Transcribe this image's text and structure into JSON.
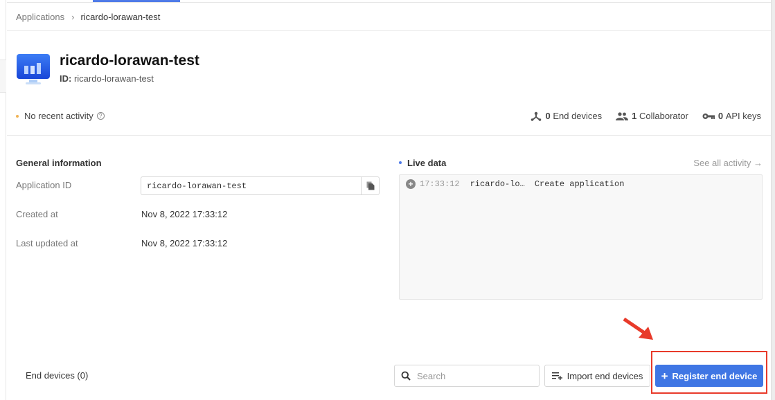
{
  "breadcrumb": {
    "parent": "Applications",
    "separator": "›",
    "current": "ricardo-lorawan-test"
  },
  "header": {
    "title": "ricardo-lorawan-test",
    "id_label": "ID:",
    "id_value": "ricardo-lorawan-test",
    "icon": "application-monitor-icon"
  },
  "status": {
    "activity": "No recent activity",
    "help_glyph": "?",
    "stats": [
      {
        "count": "0",
        "label": "End devices",
        "icon": "end-device-icon"
      },
      {
        "count": "1",
        "label": "Collaborator",
        "icon": "collaborators-icon"
      },
      {
        "count": "0",
        "label": "API keys",
        "icon": "key-icon"
      }
    ]
  },
  "general_info": {
    "title": "General information",
    "fields": [
      {
        "label": "Application ID",
        "value": "ricardo-lorawan-test"
      },
      {
        "label": "Created at",
        "value": "Nov 8, 2022 17:33:12"
      },
      {
        "label": "Last updated at",
        "value": "Nov 8, 2022 17:33:12"
      }
    ]
  },
  "live_data": {
    "title": "Live data",
    "see_all": "See all activity →",
    "events": [
      {
        "icon": "+",
        "time": "17:33:12",
        "entity": "ricardo-lo…",
        "name": "Create application"
      }
    ]
  },
  "end_devices": {
    "title": "End devices (0)",
    "search_placeholder": "Search",
    "import_label": "Import end devices",
    "register_label": "Register end device",
    "register_plus": "+"
  },
  "colors": {
    "accent": "#3f76e4",
    "annotation": "#e83a2a",
    "activity_dot": "#f0b355"
  }
}
